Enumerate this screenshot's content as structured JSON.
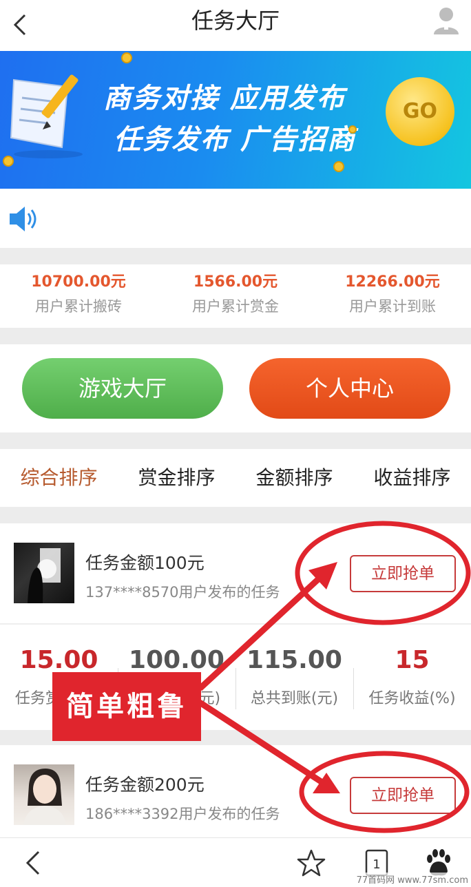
{
  "header": {
    "title": "任务大厅"
  },
  "banner": {
    "line1": "商务对接 应用发布",
    "line2": "任务发布 广告招商",
    "go_label": "GO"
  },
  "stats": [
    {
      "value": "10700.00元",
      "label": "用户累计搬砖"
    },
    {
      "value": "1566.00元",
      "label": "用户累计赏金"
    },
    {
      "value": "12266.00元",
      "label": "用户累计到账"
    }
  ],
  "buttons": {
    "game_hall": "游戏大厅",
    "personal_center": "个人中心"
  },
  "sort_tabs": [
    {
      "label": "综合排序",
      "active": true
    },
    {
      "label": "赏金排序"
    },
    {
      "label": "金额排序"
    },
    {
      "label": "收益排序"
    }
  ],
  "tasks": [
    {
      "title": "任务金额100元",
      "subtitle": "137****8570用户发布的任务",
      "action": "立即抢单",
      "metrics": [
        {
          "value": "15.00",
          "label": "任务赏金(元)"
        },
        {
          "value": "100.00",
          "label": "任务金额(元)"
        },
        {
          "value": "115.00",
          "label": "总共到账(元)"
        },
        {
          "value": "15",
          "label": "任务收益(%)"
        }
      ]
    },
    {
      "title": "任务金额200元",
      "subtitle": "186****3392用户发布的任务",
      "action": "立即抢单"
    }
  ],
  "annotation": {
    "label": "简单粗鲁",
    "color": "#e0252d"
  },
  "bottom_nav": {
    "tab_count": "1"
  },
  "watermark": "77首码网 www.77sm.com",
  "colors": {
    "accent_red": "#c8272b",
    "orange": "#e4572e",
    "green": "#4fae4a"
  }
}
